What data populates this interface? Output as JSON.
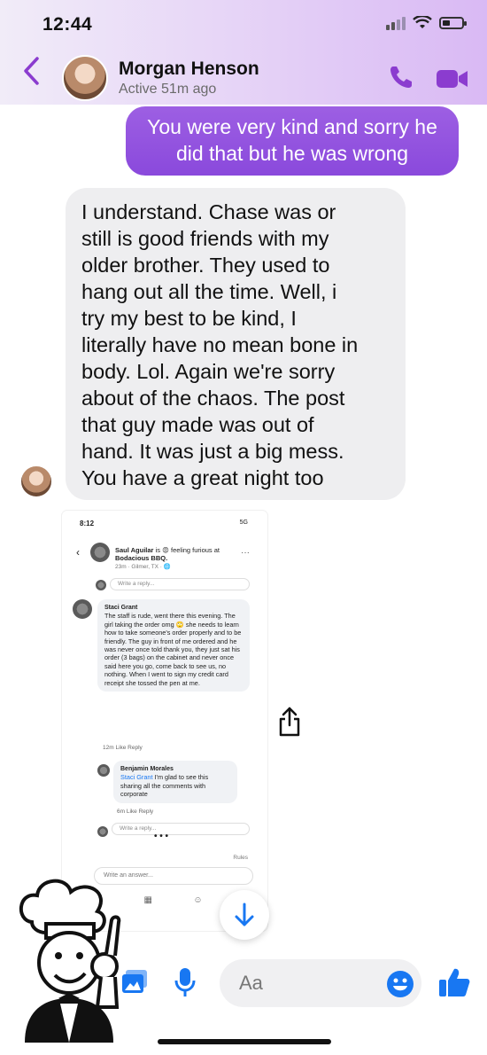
{
  "status_bar": {
    "time": "12:44"
  },
  "header": {
    "contact_name": "Morgan Henson",
    "status": "Active 51m ago",
    "accent_color": "#8b3ccf"
  },
  "messages": {
    "outgoing": "You were very kind and sorry he did that but he was wrong",
    "incoming": "I understand. Chase was or\nstill is good friends with my\nolder brother. They used to\nhang out all the time. Well, i\ntry my best to be kind, I\nliterally have no mean bone in\nbody. Lol.  Again we're sorry\nabout of the chaos. The post\nthat guy made was out of\nhand. It was just a big mess.\nYou have a great night too"
  },
  "shared_screenshot": {
    "time": "8:12",
    "signal": "5G",
    "post_author": "Saul Aguilar",
    "post_text": "is 😡 feeling furious at",
    "post_place": "Bodacious BBQ.",
    "post_meta": "23m · Gilmer, TX · 🌐",
    "write_reply": "Write a reply...",
    "comment1_author": "Staci Grant",
    "comment1_text": "The staff is rude, went there this evening. The girl taking the order omg 🙄 she needs to learn how to take someone's order properly and to be friendly.  The guy in front of me ordered and he was never once told thank you, they just sat his order (3 bags) on the cabinet and never once said here you go, come back to see us, no nothing. When I went to sign my credit card receipt she tossed the pen at me.",
    "comment1_actions": "12m   Like   Reply",
    "comment2_author": "Benjamin Morales",
    "comment2_tag": "Staci Grant",
    "comment2_text": " I'm glad to see this sharing all the comments with corporate",
    "comment2_actions": "6m   Like   Reply",
    "more": "• • •",
    "rules": "Rules",
    "write_answer": "Write an answer..."
  },
  "composer": {
    "placeholder": "Aa"
  },
  "icons": [
    "back-arrow-icon",
    "phone-icon",
    "video-camera-icon",
    "share-icon",
    "arrow-down-icon",
    "image-icon",
    "microphone-icon",
    "emoji-icon",
    "thumbs-up-icon"
  ]
}
